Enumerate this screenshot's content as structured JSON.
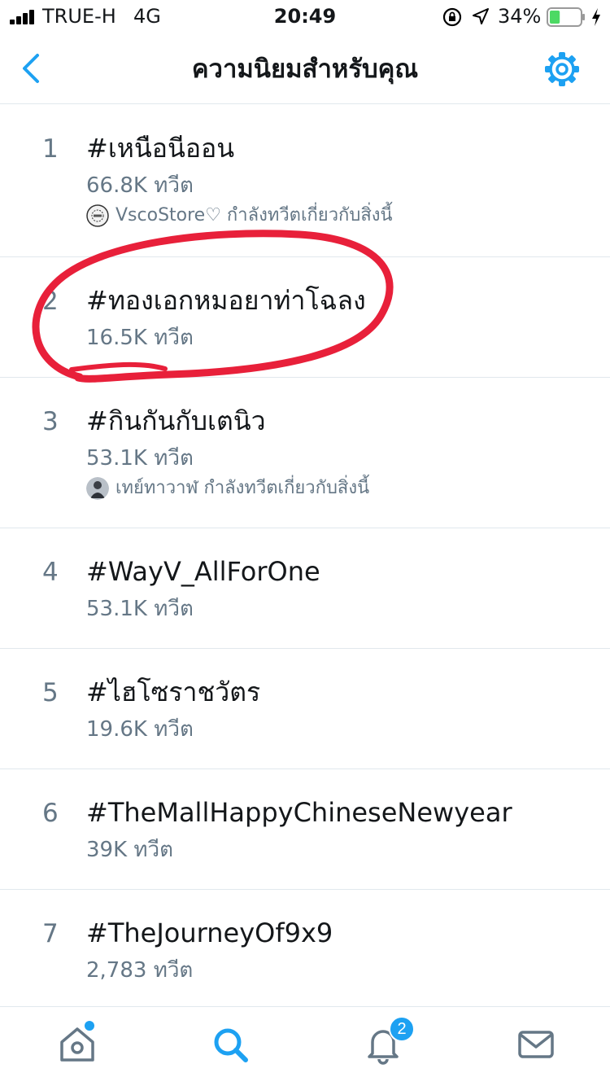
{
  "status_bar": {
    "carrier": "TRUE-H",
    "network": "4G",
    "time": "20:49",
    "battery_percent": "34%",
    "battery_level": 0.34,
    "icons": [
      "signal-icon",
      "lock-rotation-icon",
      "location-icon",
      "battery-icon",
      "charging-icon"
    ]
  },
  "nav": {
    "title": "ความนิยมสำหรับคุณ",
    "back_icon": "chevron-left-icon",
    "settings_icon": "gear-icon"
  },
  "trends": [
    {
      "rank": "1",
      "tag": "#เหนือนีออน",
      "count": "66.8K ทวีต",
      "context": "VscoStore♡ กำลังทวีตเกี่ยวกับสิ่งนี้"
    },
    {
      "rank": "2",
      "tag": "#ทองเอกหมอยาท่าโฉลง",
      "count": "16.5K ทวีต"
    },
    {
      "rank": "3",
      "tag": "#กินกันกับเตนิว",
      "count": "53.1K ทวีต",
      "context": "เทย์ทาวาฬ กำลังทวีตเกี่ยวกับสิ่งนี้"
    },
    {
      "rank": "4",
      "tag": "#WayV_AllForOne",
      "count": "53.1K ทวีต"
    },
    {
      "rank": "5",
      "tag": "#ไฮโซราชวัตร",
      "count": "19.6K ทวีต"
    },
    {
      "rank": "6",
      "tag": "#TheMallHappyChineseNewyear",
      "count": "39K ทวีต"
    },
    {
      "rank": "7",
      "tag": "#TheJourneyOf9x9",
      "count": "2,783 ทวีต"
    }
  ],
  "tab_bar": {
    "tabs": [
      "home-icon",
      "search-icon",
      "bell-icon",
      "mail-icon"
    ],
    "notification_count": "2"
  },
  "colors": {
    "accent": "#1da1f2",
    "text_primary": "#14171a",
    "text_secondary": "#657786",
    "divider": "#e1e8ed",
    "annotation": "#e8203a"
  }
}
